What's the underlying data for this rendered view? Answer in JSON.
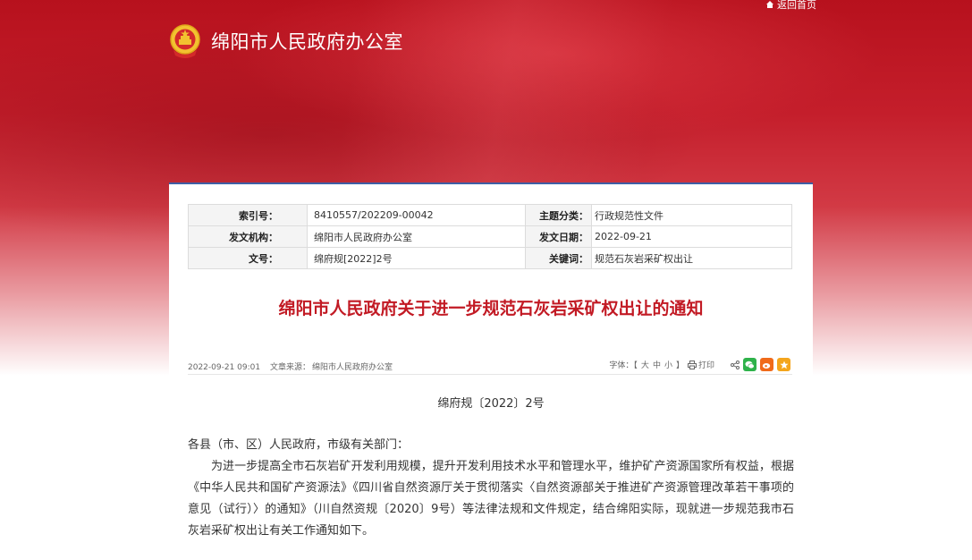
{
  "header": {
    "home_link": "返回首页",
    "site_title": "绵阳市人民政府办公室"
  },
  "meta": {
    "index_label": "索引号：",
    "index_value": "8410557/202209-00042",
    "topic_label": "主题分类：",
    "topic_value": "行政规范性文件",
    "issuer_label": "发文机构：",
    "issuer_value": "绵阳市人民政府办公室",
    "date_label": "发文日期：",
    "date_value": "2022-09-21",
    "docno_label": "文号：",
    "docno_value": "绵府规[2022]2号",
    "keywords_label": "关键词：",
    "keywords_value": "规范石灰岩采矿权出让"
  },
  "article": {
    "title": "绵阳市人民政府关于进一步规范石灰岩采矿权出让的通知",
    "datetime": "2022-09-21 09:01",
    "source_label": "文章来源：",
    "source_value": "绵阳市人民政府办公室",
    "font_label": "字体：【",
    "font_large": "大",
    "font_medium": "中",
    "font_small": "小",
    "font_close": "】",
    "print_label": "打印",
    "doc_number": "绵府规〔2022〕2号",
    "salutation": "各县（市、区）人民政府，市级有关部门：",
    "paragraph1": "为进一步提高全市石灰岩矿开发利用规模，提升开发利用技术水平和管理水平，维护矿产资源国家所有权益，根据《中华人民共和国矿产资源法》《四川省自然资源厅关于贯彻落实〈自然资源部关于推进矿产资源管理改革若干事项的意见（试行）〉的通知》（川自然资规〔2020〕9号）等法律法规和文件规定，结合绵阳实际，现就进一步规范我市石灰岩采矿权出让有关工作通知如下。"
  },
  "colors": {
    "banner_red": "#c41e2b",
    "title_red": "#c21a24",
    "panel_border": "#3e5fa5",
    "wechat_green": "#2eb24a",
    "weibo_orange": "#f06a1a",
    "favorite_orange": "#f4a51c"
  },
  "icons": [
    "home-icon",
    "national-emblem-icon",
    "print-icon",
    "share-icon",
    "wechat-icon",
    "weibo-icon",
    "favorite-icon"
  ]
}
